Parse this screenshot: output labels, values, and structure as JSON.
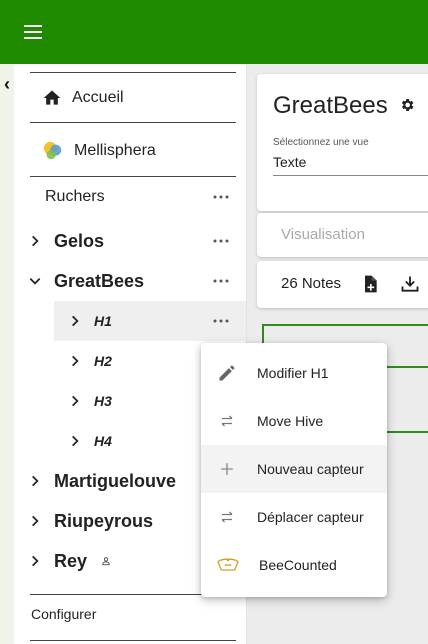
{
  "header": {
    "menu_icon": "hamburger-icon"
  },
  "sidebar": {
    "collapse_icon": "chevron-left-icon",
    "accueil": "Accueil",
    "mellisphera": "Mellisphera",
    "ruchers": "Ruchers",
    "apiaries": [
      {
        "label": "Gelos",
        "expanded": false
      },
      {
        "label": "GreatBees",
        "expanded": true
      },
      {
        "label": "Martiguelouve",
        "expanded": false
      },
      {
        "label": "Riupeyrous",
        "expanded": false
      },
      {
        "label": "Rey",
        "expanded": false,
        "shared": true
      }
    ],
    "hives": [
      "H1",
      "H2",
      "H3",
      "H4"
    ],
    "configurer": "Configurer"
  },
  "main": {
    "title": "GreatBees",
    "select_label": "Sélectionnez une vue",
    "select_value": "Texte",
    "visualisation": "Visualisation",
    "notes": "26 Notes"
  },
  "context_menu": {
    "items": [
      {
        "label": "Modifier H1",
        "icon": "pencil-icon"
      },
      {
        "label": "Move Hive",
        "icon": "swap-arrows-icon"
      },
      {
        "label": "Nouveau capteur",
        "icon": "plus-icon"
      },
      {
        "label": "Déplacer capteur",
        "icon": "swap-arrows-icon"
      },
      {
        "label": "BeeCounted",
        "icon": "beecounter-icon"
      }
    ]
  },
  "colors": {
    "topbar": "#1f8a00",
    "accent_border": "#2f8a1e"
  }
}
